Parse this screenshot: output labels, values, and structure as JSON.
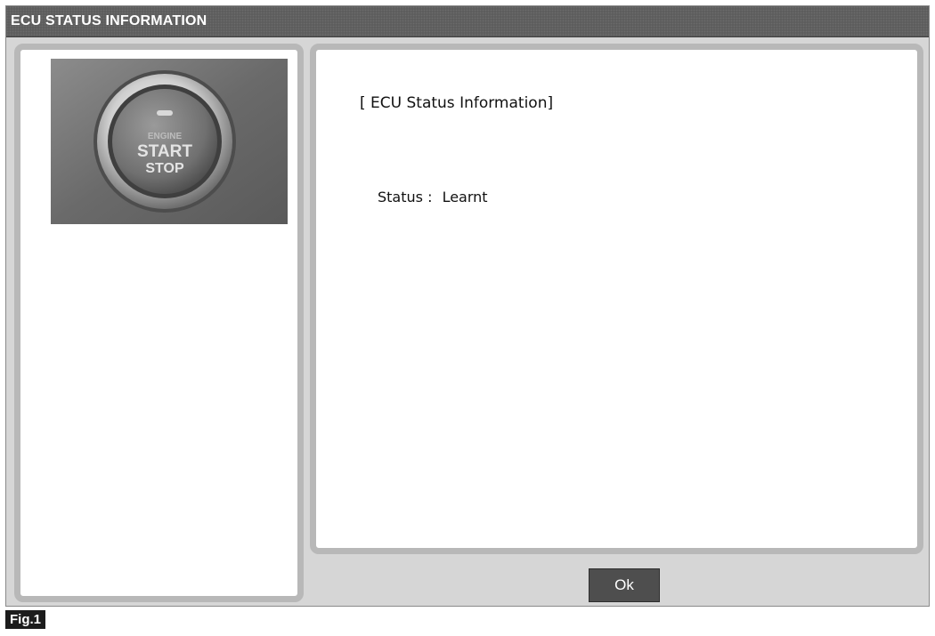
{
  "window": {
    "title": "ECU STATUS INFORMATION"
  },
  "photo": {
    "subject": "engine-start-stop-button-photo",
    "button_lines": [
      "ENGINE",
      "START",
      "STOP"
    ]
  },
  "info": {
    "heading": "[ ECU Status Information]",
    "status_label": "Status :",
    "status_value": "Learnt"
  },
  "actions": {
    "ok_label": "Ok"
  },
  "figure": {
    "caption": "Fig.1"
  },
  "colors": {
    "titlebar": "#5a5a5a",
    "panel_border": "#b8b8b8",
    "button": "#4e4e4e"
  }
}
